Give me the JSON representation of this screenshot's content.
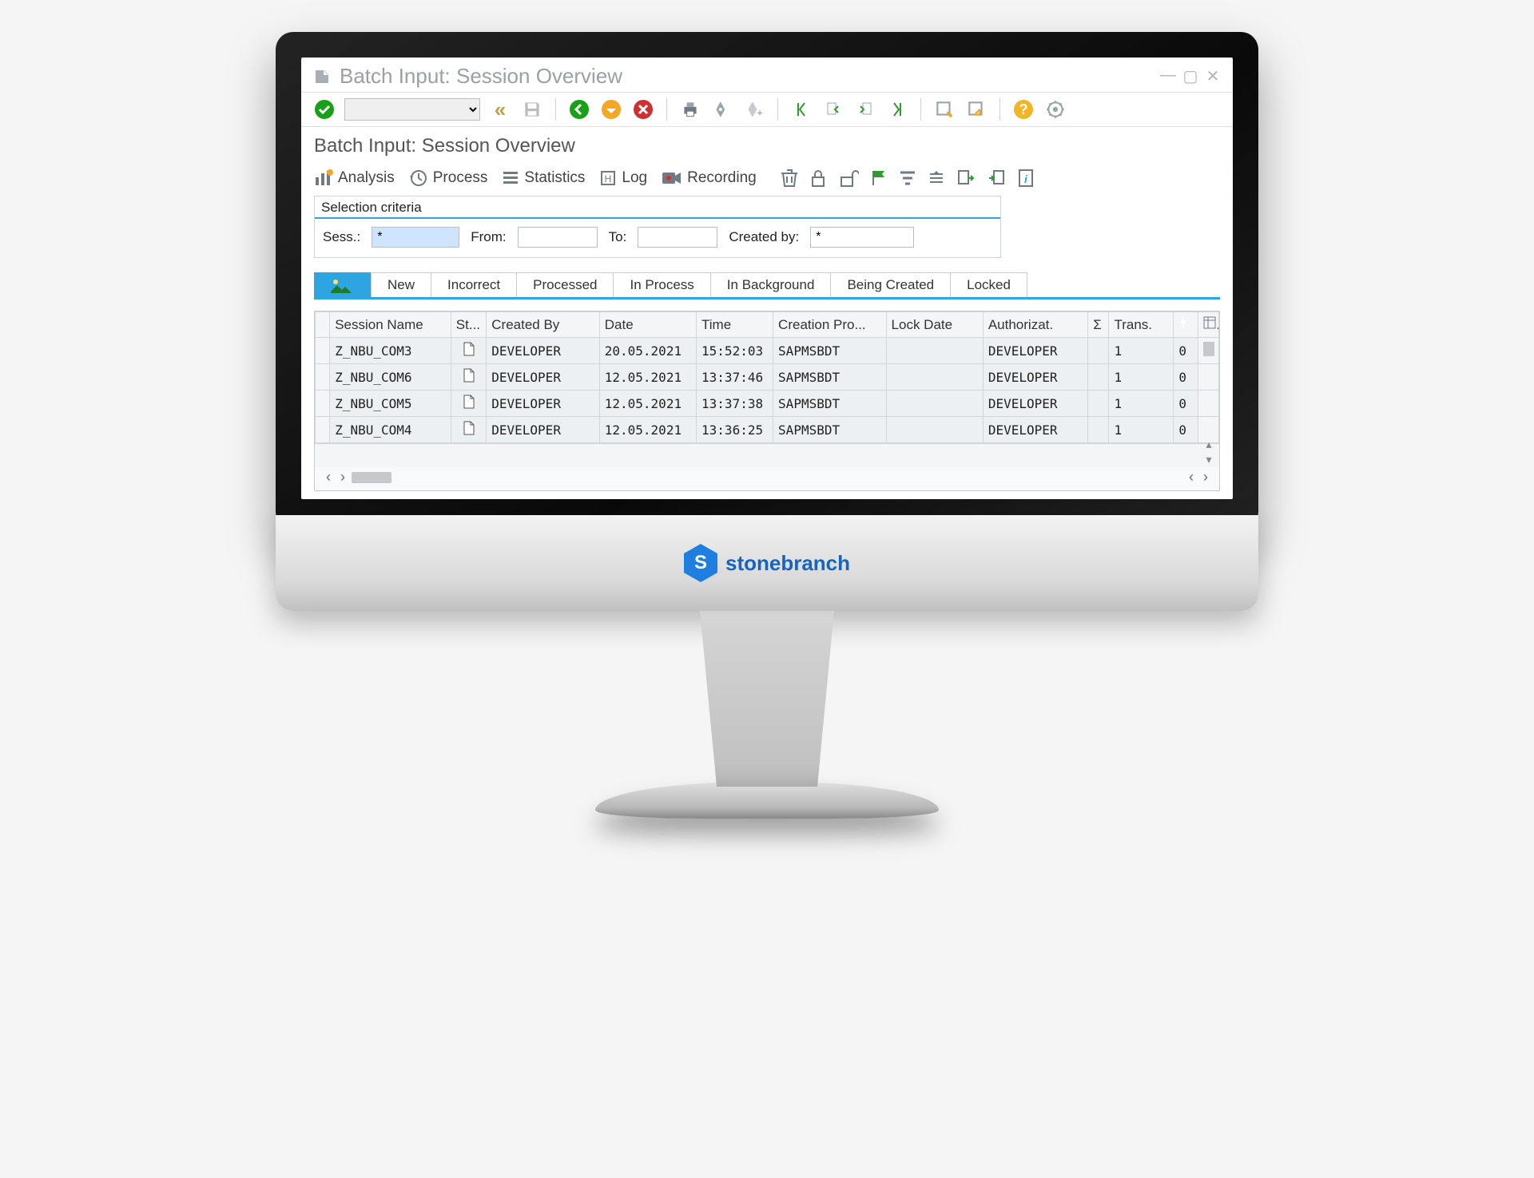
{
  "window": {
    "title": "Batch Input: Session Overview"
  },
  "page": {
    "title": "Batch Input: Session Overview"
  },
  "sub_toolbar": {
    "analysis": "Analysis",
    "process": "Process",
    "statistics": "Statistics",
    "log": "Log",
    "recording": "Recording"
  },
  "criteria": {
    "title": "Selection criteria",
    "sess_label": "Sess.:",
    "sess_value": "*",
    "from_label": "From:",
    "from_value": "",
    "to_label": "To:",
    "to_value": "",
    "by_label": "Created by:",
    "by_value": "*"
  },
  "tabs": [
    "New",
    "Incorrect",
    "Processed",
    "In Process",
    "In Background",
    "Being Created",
    "Locked"
  ],
  "grid": {
    "columns": [
      "Session Name",
      "St...",
      "Created By",
      "Date",
      "Time",
      "Creation Pro...",
      "Lock Date",
      "Authorizat.",
      "Σ",
      "Trans.",
      "⚡"
    ],
    "rows": [
      {
        "session": "Z_NBU_COM3",
        "created_by": "DEVELOPER",
        "date": "20.05.2021",
        "time": "15:52:03",
        "prog": "SAPMSBDT",
        "lock": "",
        "auth": "DEVELOPER",
        "trans": "1",
        "err": "0"
      },
      {
        "session": "Z_NBU_COM6",
        "created_by": "DEVELOPER",
        "date": "12.05.2021",
        "time": "13:37:46",
        "prog": "SAPMSBDT",
        "lock": "",
        "auth": "DEVELOPER",
        "trans": "1",
        "err": "0"
      },
      {
        "session": "Z_NBU_COM5",
        "created_by": "DEVELOPER",
        "date": "12.05.2021",
        "time": "13:37:38",
        "prog": "SAPMSBDT",
        "lock": "",
        "auth": "DEVELOPER",
        "trans": "1",
        "err": "0"
      },
      {
        "session": "Z_NBU_COM4",
        "created_by": "DEVELOPER",
        "date": "12.05.2021",
        "time": "13:36:25",
        "prog": "SAPMSBDT",
        "lock": "",
        "auth": "DEVELOPER",
        "trans": "1",
        "err": "0"
      }
    ]
  },
  "brand": {
    "letter": "S",
    "name": "stonebranch"
  }
}
